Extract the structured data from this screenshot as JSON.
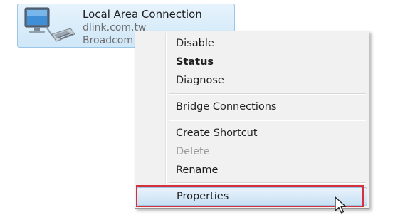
{
  "adapter": {
    "name": "Local Area Connection",
    "network": "dlink.com.tw",
    "device": "Broadcom",
    "icon": "network-adapter-icon"
  },
  "context_menu": {
    "items": [
      {
        "label": "Disable",
        "style": "normal"
      },
      {
        "label": "Status",
        "style": "bold"
      },
      {
        "label": "Diagnose",
        "style": "normal"
      },
      {
        "label": "Bridge Connections",
        "style": "normal"
      },
      {
        "label": "Create Shortcut",
        "style": "normal"
      },
      {
        "label": "Delete",
        "style": "disabled"
      },
      {
        "label": "Rename",
        "style": "normal"
      },
      {
        "label": "Properties",
        "style": "highlighted"
      }
    ],
    "highlight_outline_color": "#d5313a"
  },
  "cursor": {
    "icon": "mouse-pointer-icon"
  }
}
